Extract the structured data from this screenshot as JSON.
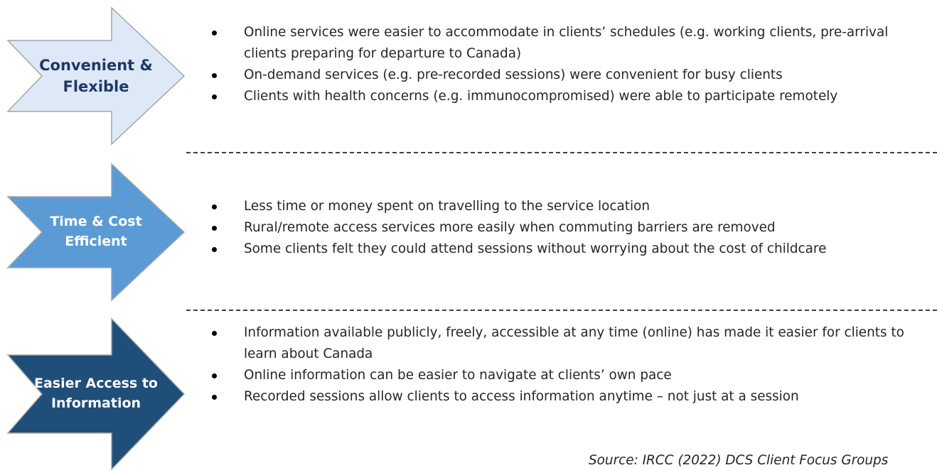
{
  "colors": {
    "arrow1_fill": "#dde9f7",
    "arrow1_stroke": "#a6a6a6",
    "arrow1_text": "#1f3864",
    "arrow2_fill": "#5b9bd5",
    "arrow2_stroke": "#a6a6a6",
    "arrow2_text": "#ffffff",
    "arrow3_fill": "#1f4e79",
    "arrow3_stroke": "#a6a6a6",
    "arrow3_text": "#ffffff",
    "divider": "#404040"
  },
  "sections": [
    {
      "label": "Convenient & Flexible",
      "bullets": [
        "Online services were easier to accommodate in clients’ schedules (e.g. working clients, pre-arrival clients preparing for departure to Canada)",
        "On-demand services (e.g. pre-recorded sessions) were convenient for busy clients",
        "Clients with health concerns (e.g. immunocompromised) were able to participate remotely"
      ]
    },
    {
      "label": "Time & Cost Efficient",
      "bullets": [
        "Less time or money spent on travelling to the service location",
        "Rural/remote access services more easily when commuting barriers are removed",
        "Some clients felt they could attend sessions without worrying about the cost of childcare"
      ]
    },
    {
      "label": "Easier Access to Information",
      "bullets": [
        "Information available publicly, freely, accessible at any time (online) has made it easier for clients to learn about Canada",
        "Online information can be easier to navigate at clients’ own pace",
        "Recorded sessions allow clients to access information anytime – not just at a session"
      ]
    }
  ],
  "source": "Source: IRCC (2022) DCS Client Focus Groups"
}
